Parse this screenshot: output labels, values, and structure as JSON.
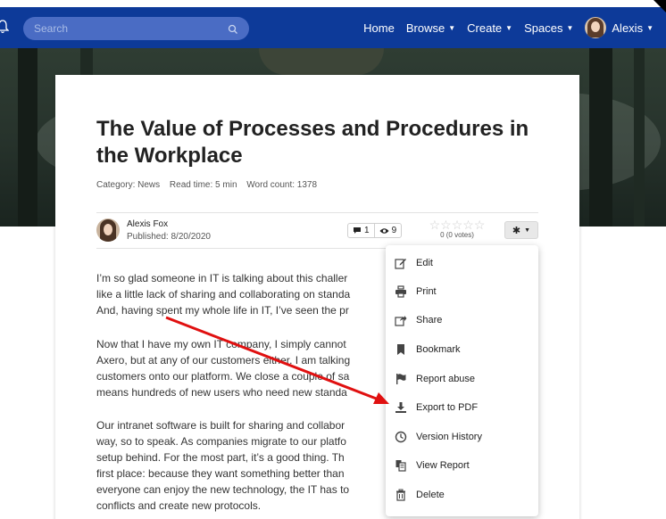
{
  "nav": {
    "search_placeholder": "Search",
    "links": [
      "Home",
      "Browse",
      "Create",
      "Spaces"
    ],
    "user_name": "Alexis",
    "brand_color": "#0d3a99"
  },
  "article": {
    "title": "The Value of Processes and Procedures in the Workplace",
    "category": "Category: News",
    "read_time": "Read time: 5 min",
    "word_count": "Word count: 1378",
    "author": "Alexis Fox",
    "published": "Published: 8/20/2020",
    "comments": "1",
    "views": "9",
    "rating_votes": "0 (0 votes)",
    "paragraphs": [
      [
        "I’m so glad someone in IT is talking about this challer",
        "like a little lack of sharing and collaborating on standa",
        "And, having spent my whole life in IT, I’ve seen the pr"
      ],
      [
        "Now that I have my own IT company, I simply cannot",
        "Axero, but at any of our customers either. I am talking",
        "customers onto our platform. We close a couple of sa",
        "means hundreds of new users who need new standa"
      ],
      [
        "Our intranet software is built for sharing and collabor",
        "way, so to speak. As companies migrate to our platfo",
        "setup behind. For the most part, it’s a good thing. Th",
        "first place: because they want something better than",
        "everyone can enjoy the new technology, the IT has to",
        "conflicts and create new protocols."
      ]
    ]
  },
  "menu": {
    "items": [
      {
        "label": "Edit",
        "icon": "edit-icon"
      },
      {
        "label": "Print",
        "icon": "print-icon"
      },
      {
        "label": "Share",
        "icon": "share-icon"
      },
      {
        "label": "Bookmark",
        "icon": "bookmark-icon"
      },
      {
        "label": "Report abuse",
        "icon": "flag-icon"
      },
      {
        "label": "Export to PDF",
        "icon": "download-icon"
      },
      {
        "label": "Version History",
        "icon": "clock-icon"
      },
      {
        "label": "View Report",
        "icon": "report-icon"
      },
      {
        "label": "Delete",
        "icon": "trash-icon"
      }
    ]
  },
  "annotation": {
    "arrow_color": "#e01010",
    "target": "Export to PDF"
  }
}
